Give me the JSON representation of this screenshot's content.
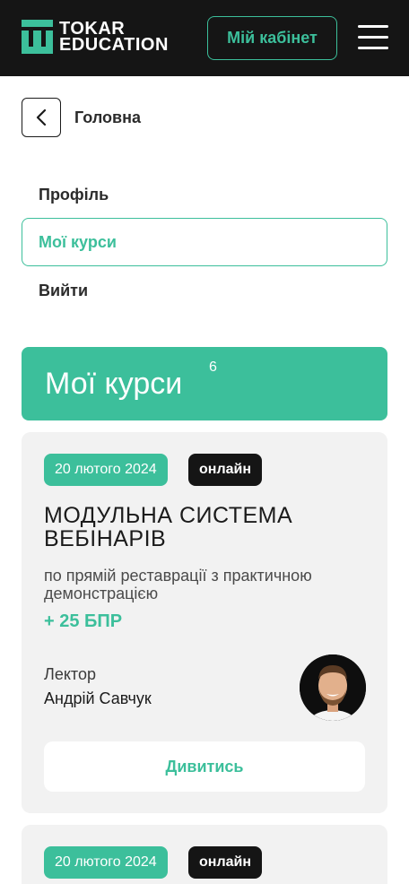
{
  "header": {
    "logo_line1": "TOKAR",
    "logo_line2": "EDUCATION",
    "cabinet_label": "Мій кабінет",
    "menu_icon": "hamburger-icon"
  },
  "nav": {
    "back_label": "Головна",
    "back_icon": "chevron-left-icon",
    "items": [
      {
        "label": "Профіль"
      },
      {
        "label": "Мої курси"
      },
      {
        "label": "Вийти"
      }
    ]
  },
  "courses": {
    "title": "Мої курси",
    "count": "6",
    "list": [
      {
        "date": "20 лютого 2024",
        "format": "онлайн",
        "title": "МОДУЛЬНА СИСТЕМА ВЕБІНАРІВ",
        "subtitle": "по прямій реставрації з практичною демонстрацією",
        "bpr": "+ 25 БПР",
        "lector_label": "Лектор",
        "lector_name": "Андрій Савчук",
        "button": "Дивитись"
      },
      {
        "date": "20 лютого 2024",
        "format": "онлайн"
      }
    ]
  },
  "colors": {
    "accent": "#3cbf9b",
    "dark": "#151515",
    "card_bg": "#f2f2f2"
  }
}
